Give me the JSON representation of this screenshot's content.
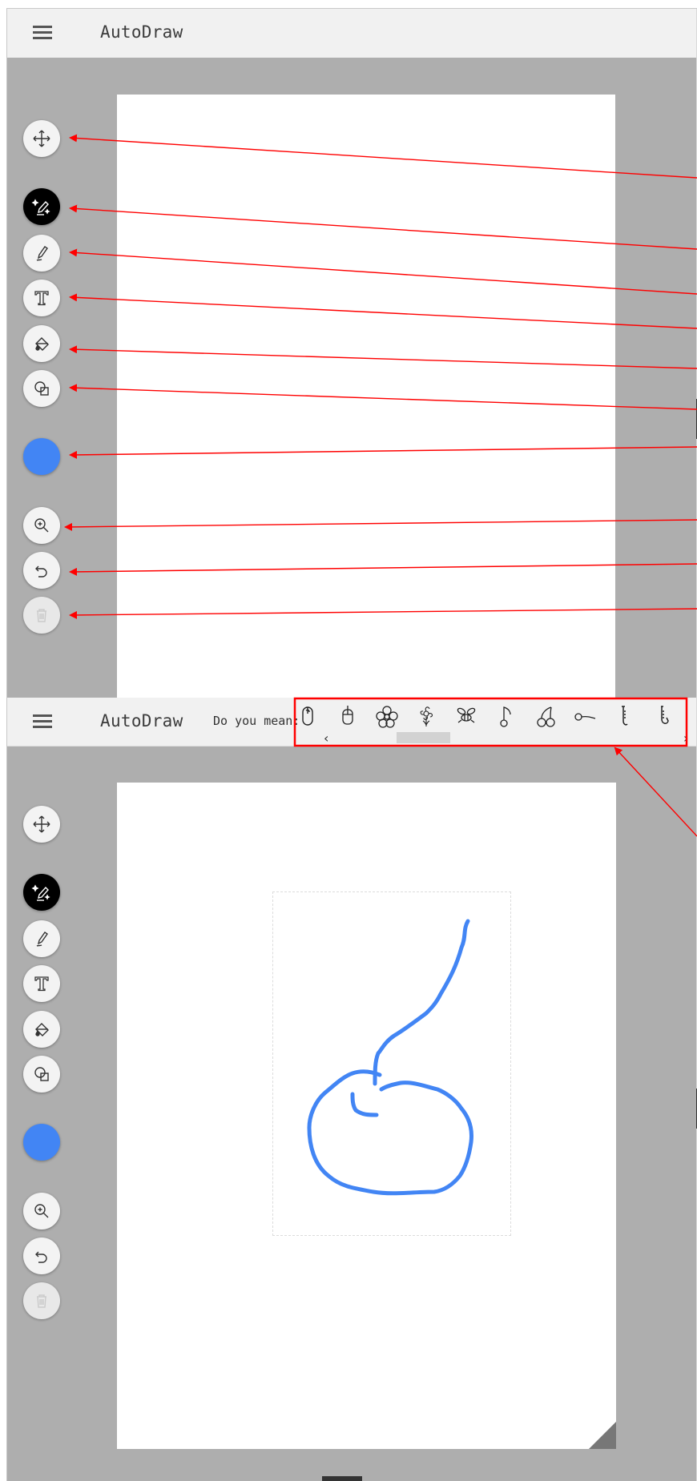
{
  "app": {
    "title": "AutoDraw",
    "accent_color": "#4285f4",
    "annotation_color": "#ff0000"
  },
  "toolbar": {
    "tools": [
      {
        "id": "move",
        "icon": "move-icon",
        "label": "Select"
      },
      {
        "id": "autodraw",
        "icon": "autodraw-sparkle-pencil-icon",
        "label": "AutoDraw",
        "active": true
      },
      {
        "id": "draw",
        "icon": "pencil-icon",
        "label": "Draw"
      },
      {
        "id": "type",
        "icon": "text-icon",
        "label": "Type"
      },
      {
        "id": "fill",
        "icon": "paint-bucket-icon",
        "label": "Fill"
      },
      {
        "id": "shape",
        "icon": "shapes-icon",
        "label": "Shape"
      },
      {
        "id": "color",
        "icon": "color-swatch",
        "label": "Color",
        "color": "#4285f4"
      },
      {
        "id": "zoom",
        "icon": "zoom-in-icon",
        "label": "Zoom"
      },
      {
        "id": "undo",
        "icon": "undo-icon",
        "label": "Undo"
      },
      {
        "id": "delete",
        "icon": "trash-icon",
        "label": "Delete",
        "disabled": true
      }
    ]
  },
  "suggestions": {
    "prompt": "Do you mean:",
    "items": [
      {
        "icon": "computer-mouse-icon"
      },
      {
        "icon": "computer-mouse-outline-icon"
      },
      {
        "icon": "flower-icon"
      },
      {
        "icon": "flower-outline-icon"
      },
      {
        "icon": "bee-icon"
      },
      {
        "icon": "music-note-icon"
      },
      {
        "icon": "cherry-icon"
      },
      {
        "icon": "key-icon"
      },
      {
        "icon": "saxophone-icon"
      },
      {
        "icon": "saxophone-outline-icon"
      }
    ],
    "scroll_left": "‹",
    "scroll_right": "›"
  },
  "drawing": {
    "stroke_color": "#4285f4",
    "subject": "cherry sketch"
  }
}
